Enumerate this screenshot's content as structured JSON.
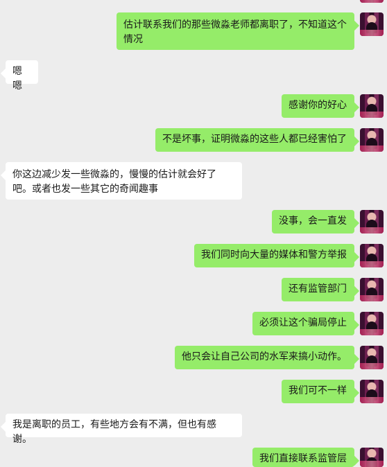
{
  "messages": [
    {
      "side": "out",
      "text": "估计联系我们的那些微淼老师都离职了，不知道这个情况"
    },
    {
      "side": "in",
      "text": "嗯嗯"
    },
    {
      "side": "out",
      "text": "感谢你的好心"
    },
    {
      "side": "out",
      "text": "不是坏事，证明微淼的这些人都已经害怕了"
    },
    {
      "side": "in",
      "text": "你这边减少发一些微淼的，慢慢的估计就会好了吧。或者也发一些其它的奇闻趣事"
    },
    {
      "side": "out",
      "text": "没事，会一直发"
    },
    {
      "side": "out",
      "text": "我们同时向大量的媒体和警方举报"
    },
    {
      "side": "out",
      "text": "还有监管部门"
    },
    {
      "side": "out",
      "text": "必须让这个骗局停止"
    },
    {
      "side": "out",
      "text": "他只会让自己公司的水军来搞小动作。"
    },
    {
      "side": "out",
      "text": "我们可不一样"
    },
    {
      "side": "in",
      "text": "我是离职的员工，有些地方会有不满，但也有感谢。"
    },
    {
      "side": "out",
      "text": "我们直接联系监管层"
    }
  ],
  "colors": {
    "background": "#ededed",
    "outgoing_bubble": "#95ec69",
    "incoming_bubble": "#ffffff",
    "text": "#191919"
  }
}
